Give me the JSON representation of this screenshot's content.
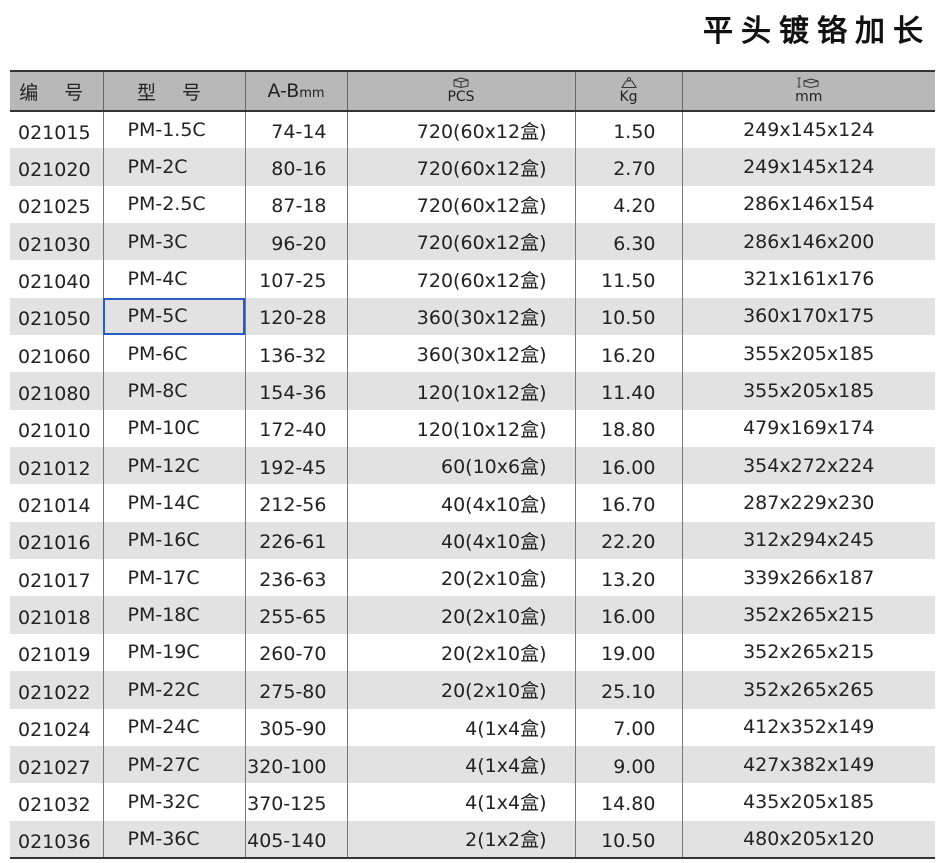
{
  "title": "平头镀铬加长",
  "headers": {
    "code": "编 号",
    "model": "型 号",
    "ab_main": "A-B",
    "ab_unit": "mm",
    "pcs": "PCS",
    "kg": "Kg",
    "dims": "mm"
  },
  "rows": [
    {
      "code": "021015",
      "model": "PM-1.5C",
      "ab": "74-14",
      "pcs": "720(60x12盒)",
      "kg": "1.50",
      "dims": "249x145x124"
    },
    {
      "code": "021020",
      "model": "PM-2C",
      "ab": "80-16",
      "pcs": "720(60x12盒)",
      "kg": "2.70",
      "dims": "249x145x124"
    },
    {
      "code": "021025",
      "model": "PM-2.5C",
      "ab": "87-18",
      "pcs": "720(60x12盒)",
      "kg": "4.20",
      "dims": "286x146x154"
    },
    {
      "code": "021030",
      "model": "PM-3C",
      "ab": "96-20",
      "pcs": "720(60x12盒)",
      "kg": "6.30",
      "dims": "286x146x200"
    },
    {
      "code": "021040",
      "model": "PM-4C",
      "ab": "107-25",
      "pcs": "720(60x12盒)",
      "kg": "11.50",
      "dims": "321x161x176"
    },
    {
      "code": "021050",
      "model": "PM-5C",
      "ab": "120-28",
      "pcs": "360(30x12盒)",
      "kg": "10.50",
      "dims": "360x170x175"
    },
    {
      "code": "021060",
      "model": "PM-6C",
      "ab": "136-32",
      "pcs": "360(30x12盒)",
      "kg": "16.20",
      "dims": "355x205x185"
    },
    {
      "code": "021080",
      "model": "PM-8C",
      "ab": "154-36",
      "pcs": "120(10x12盒)",
      "kg": "11.40",
      "dims": "355x205x185"
    },
    {
      "code": "021010",
      "model": "PM-10C",
      "ab": "172-40",
      "pcs": "120(10x12盒)",
      "kg": "18.80",
      "dims": "479x169x174"
    },
    {
      "code": "021012",
      "model": "PM-12C",
      "ab": "192-45",
      "pcs": "60(10x6盒)",
      "kg": "16.00",
      "dims": "354x272x224"
    },
    {
      "code": "021014",
      "model": "PM-14C",
      "ab": "212-56",
      "pcs": "40(4x10盒)",
      "kg": "16.70",
      "dims": "287x229x230"
    },
    {
      "code": "021016",
      "model": "PM-16C",
      "ab": "226-61",
      "pcs": "40(4x10盒)",
      "kg": "22.20",
      "dims": "312x294x245"
    },
    {
      "code": "021017",
      "model": "PM-17C",
      "ab": "236-63",
      "pcs": "20(2x10盒)",
      "kg": "13.20",
      "dims": "339x266x187"
    },
    {
      "code": "021018",
      "model": "PM-18C",
      "ab": "255-65",
      "pcs": "20(2x10盒)",
      "kg": "16.00",
      "dims": "352x265x215"
    },
    {
      "code": "021019",
      "model": "PM-19C",
      "ab": "260-70",
      "pcs": "20(2x10盒)",
      "kg": "19.00",
      "dims": "352x265x215"
    },
    {
      "code": "021022",
      "model": "PM-22C",
      "ab": "275-80",
      "pcs": "20(2x10盒)",
      "kg": "25.10",
      "dims": "352x265x265"
    },
    {
      "code": "021024",
      "model": "PM-24C",
      "ab": "305-90",
      "pcs": "4(1x4盒)",
      "kg": "7.00",
      "dims": "412x352x149"
    },
    {
      "code": "021027",
      "model": "PM-27C",
      "ab": "320-100",
      "pcs": "4(1x4盒)",
      "kg": "9.00",
      "dims": "427x382x149"
    },
    {
      "code": "021032",
      "model": "PM-32C",
      "ab": "370-125",
      "pcs": "4(1x4盒)",
      "kg": "14.80",
      "dims": "435x205x185"
    },
    {
      "code": "021036",
      "model": "PM-36C",
      "ab": "405-140",
      "pcs": "2(1x2盒)",
      "kg": "10.50",
      "dims": "480x205x120"
    }
  ],
  "selected_row": 5,
  "colors": {
    "header_bg": "#b8b8b8",
    "stripe_bg": "#e2e2e2",
    "selection": "#2a5cc8"
  },
  "icons": {
    "pcs": "box-icon",
    "kg": "weight-icon",
    "dims": "carton-dimension-icon"
  }
}
